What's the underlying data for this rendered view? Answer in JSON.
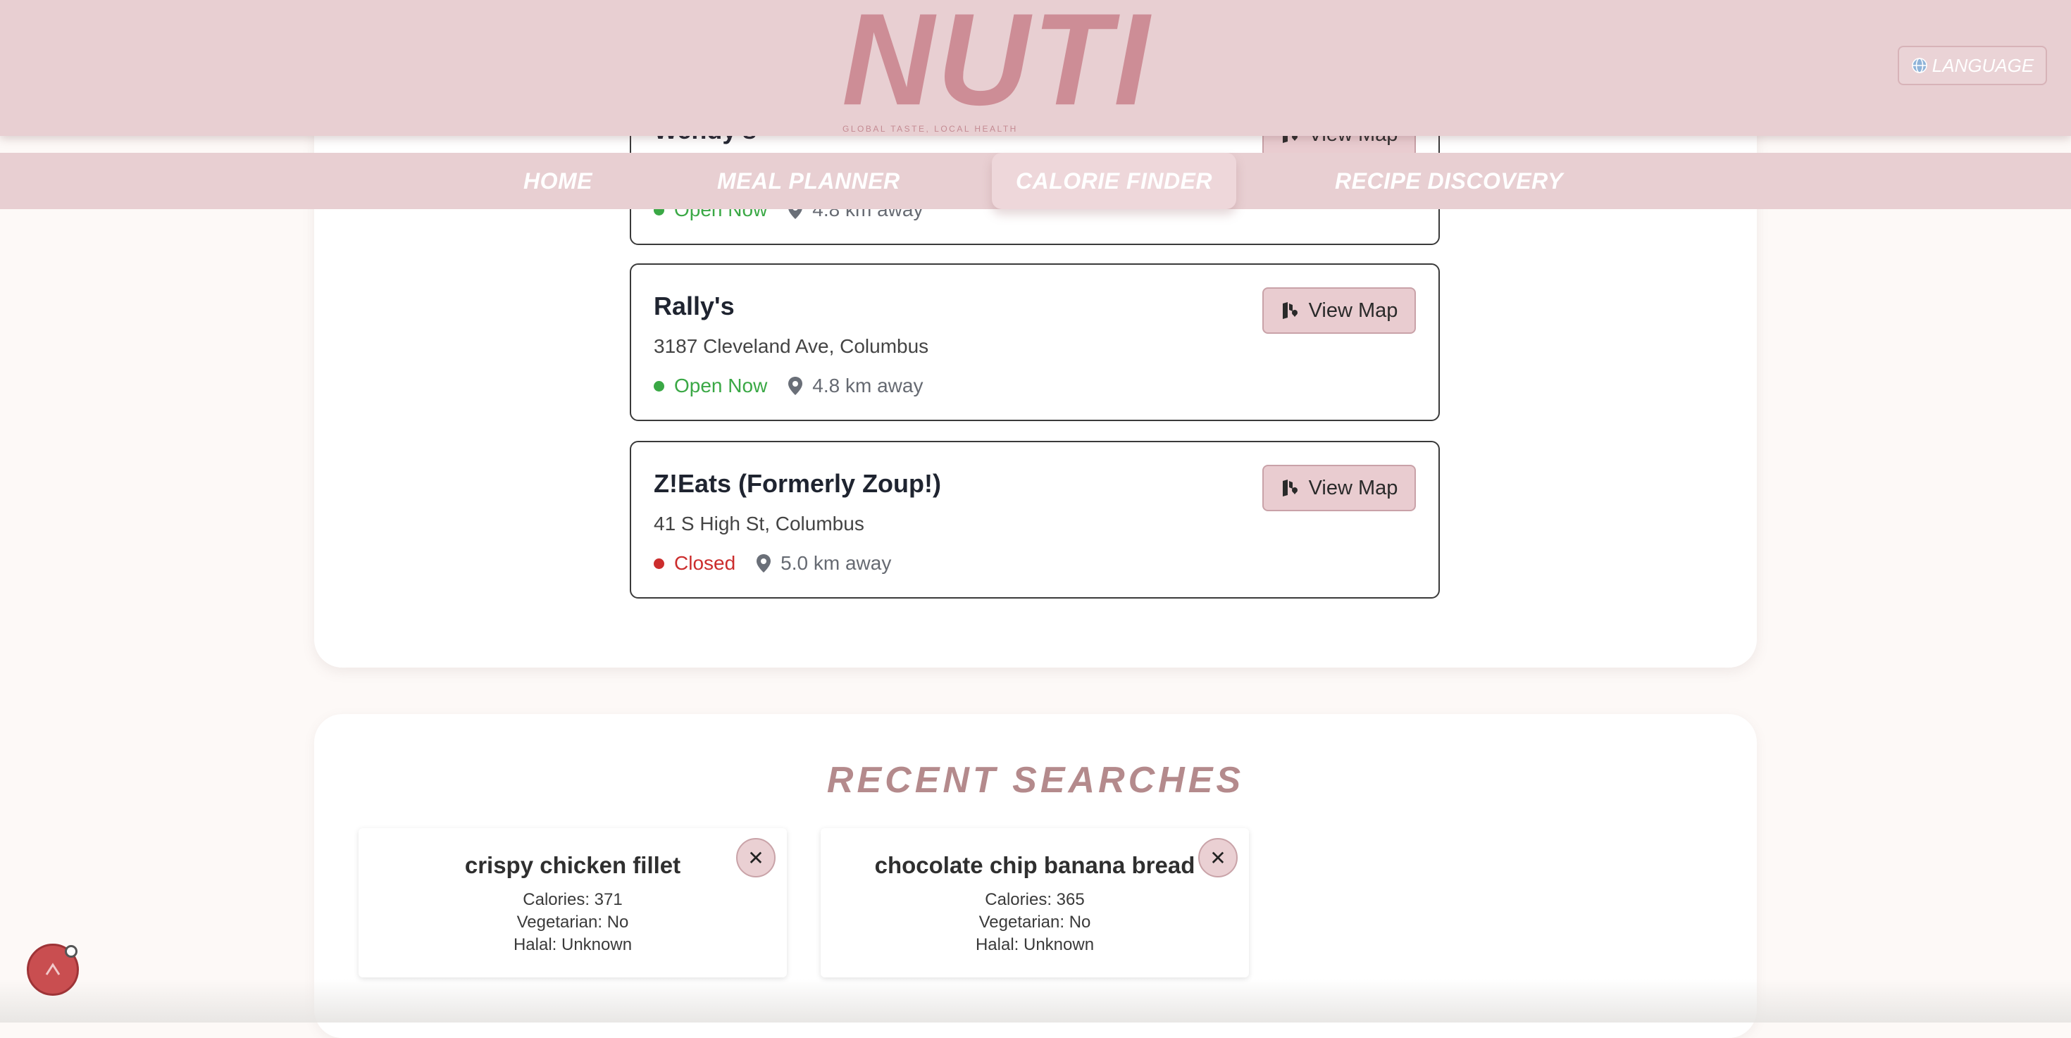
{
  "header": {
    "logo": "NUTI",
    "tagline": "GLOBAL TASTE, LOCAL HEALTH",
    "language_label": "LANGUAGE",
    "language_icon": "globe-icon"
  },
  "nav": {
    "items": [
      {
        "label": "HOME"
      },
      {
        "label": "MEAL PLANNER"
      },
      {
        "label": "CALORIE FINDER",
        "active": true
      },
      {
        "label": "RECIPE DISCOVERY"
      }
    ]
  },
  "restaurants": [
    {
      "name": "Wendy's",
      "status": "Open Now",
      "distance": "4.8 km away",
      "button": "View Map"
    },
    {
      "name": "Rally's",
      "address": "3187 Cleveland Ave, Columbus",
      "status": "Open Now",
      "distance": "4.8 km away",
      "button": "View Map"
    },
    {
      "name": "Z!Eats (Formerly Zoup!)",
      "address": "41 S High St, Columbus",
      "status": "Closed",
      "distance": "5.0 km away",
      "button": "View Map"
    }
  ],
  "recent": {
    "title": "RECENT SEARCHES",
    "items": [
      {
        "term": "crispy chicken fillet",
        "calories": "Calories: 371",
        "vegetarian": "Vegetarian: No",
        "halal": "Halal: Unknown"
      },
      {
        "term": "chocolate chip banana bread",
        "calories": "Calories: 365",
        "vegetarian": "Vegetarian: No",
        "halal": "Halal: Unknown"
      }
    ]
  },
  "colors": {
    "brand_pink": "#e8cfd2",
    "logo_pink": "#cd8d96",
    "open_green": "#3aa845",
    "closed_red": "#cc2d2d",
    "title_mauve": "#b48a8c"
  }
}
